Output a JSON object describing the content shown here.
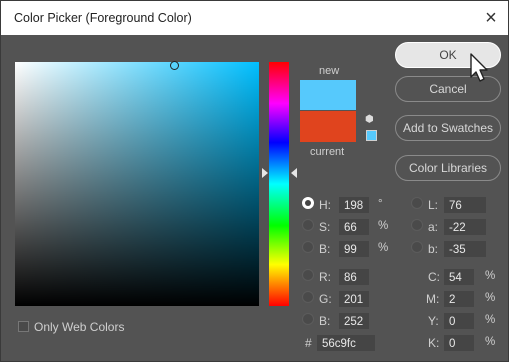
{
  "window": {
    "title": "Color Picker (Foreground Color)",
    "close": "×"
  },
  "swatch": {
    "new_label": "new",
    "current_label": "current",
    "new_color": "#56c9fc",
    "current_color": "#e0441e",
    "hsb_cube_icon": "3d-cube-icon"
  },
  "buttons": {
    "ok": "OK",
    "cancel": "Cancel",
    "add_to_swatches": "Add to Swatches",
    "color_libraries": "Color Libraries"
  },
  "fields": {
    "H": {
      "label": "H:",
      "value": "198",
      "unit": "°"
    },
    "S": {
      "label": "S:",
      "value": "66",
      "unit": "%"
    },
    "B": {
      "label": "B:",
      "value": "99",
      "unit": "%"
    },
    "R": {
      "label": "R:",
      "value": "86"
    },
    "G": {
      "label": "G:",
      "value": "201"
    },
    "Bv": {
      "label": "B:",
      "value": "252"
    },
    "L": {
      "label": "L:",
      "value": "76"
    },
    "a": {
      "label": "a:",
      "value": "-22"
    },
    "b": {
      "label": "b:",
      "value": "-35"
    },
    "C": {
      "label": "C:",
      "value": "54",
      "unit": "%"
    },
    "M": {
      "label": "M:",
      "value": "2",
      "unit": "%"
    },
    "Y": {
      "label": "Y:",
      "value": "0",
      "unit": "%"
    },
    "K": {
      "label": "K:",
      "value": "0",
      "unit": "%"
    },
    "hex": {
      "label": "#",
      "value": "56c9fc"
    }
  },
  "only_web_colors": "Only Web Colors"
}
